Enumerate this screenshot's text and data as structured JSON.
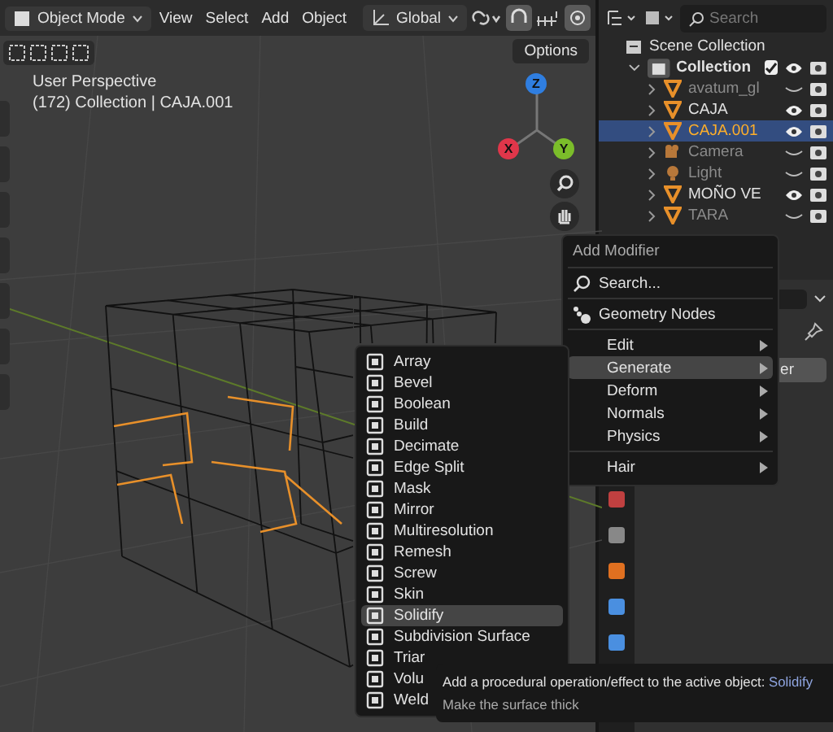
{
  "header": {
    "mode": "Object Mode",
    "menus": [
      "View",
      "Select",
      "Add",
      "Object"
    ],
    "orientation": "Global"
  },
  "viewport": {
    "view_name": "User Perspective",
    "context": "(172) Collection | CAJA.001",
    "options_button": "Options",
    "gizmo_axes": [
      {
        "label": "Z",
        "color": "#2f7ee0"
      },
      {
        "label": "X",
        "color": "#e0364a"
      },
      {
        "label": "Y",
        "color": "#7bbd2a"
      }
    ]
  },
  "outliner": {
    "search": {
      "placeholder": "Search"
    },
    "scene": "Scene Collection",
    "collection": {
      "name": "Collection",
      "checked": true
    },
    "items": [
      {
        "name": "avatum_gl",
        "kind": "mesh",
        "visible": false,
        "selected": false
      },
      {
        "name": "CAJA",
        "kind": "mesh",
        "visible": true,
        "selected": false
      },
      {
        "name": "CAJA.001",
        "kind": "mesh",
        "visible": true,
        "selected": true
      },
      {
        "name": "Camera",
        "kind": "camera",
        "visible": false,
        "selected": false
      },
      {
        "name": "Light",
        "kind": "light",
        "visible": false,
        "selected": false
      },
      {
        "name": "MOÑO VE",
        "kind": "mesh",
        "visible": true,
        "selected": false
      },
      {
        "name": "TARA",
        "kind": "mesh",
        "visible": false,
        "selected": false
      }
    ]
  },
  "properties": {
    "button_fragment": "er"
  },
  "add_modifier_menu": {
    "title": "Add Modifier",
    "search": "Search...",
    "geometry_nodes": "Geometry Nodes",
    "submenus": [
      {
        "label": "Edit",
        "selected": false
      },
      {
        "label": "Generate",
        "selected": true
      },
      {
        "label": "Deform",
        "selected": false
      },
      {
        "label": "Normals",
        "selected": false
      },
      {
        "label": "Physics",
        "selected": false
      },
      {
        "label": "Hair",
        "selected": false
      }
    ]
  },
  "generate_menu": [
    {
      "label": "Array",
      "selected": false
    },
    {
      "label": "Bevel",
      "selected": false
    },
    {
      "label": "Boolean",
      "selected": false
    },
    {
      "label": "Build",
      "selected": false
    },
    {
      "label": "Decimate",
      "selected": false
    },
    {
      "label": "Edge Split",
      "selected": false
    },
    {
      "label": "Mask",
      "selected": false
    },
    {
      "label": "Mirror",
      "selected": false
    },
    {
      "label": "Multiresolution",
      "selected": false
    },
    {
      "label": "Remesh",
      "selected": false
    },
    {
      "label": "Screw",
      "selected": false
    },
    {
      "label": "Skin",
      "selected": false
    },
    {
      "label": "Solidify",
      "selected": true
    },
    {
      "label": "Subdivision Surface",
      "selected": false
    },
    {
      "label": "Triar",
      "selected": false
    },
    {
      "label": "Volu",
      "selected": false
    },
    {
      "label": "Weld",
      "selected": false
    }
  ],
  "tooltip": {
    "text": "Add a procedural operation/effect to the active object:",
    "operator": "Solidify",
    "description": "Make the surface thick"
  }
}
